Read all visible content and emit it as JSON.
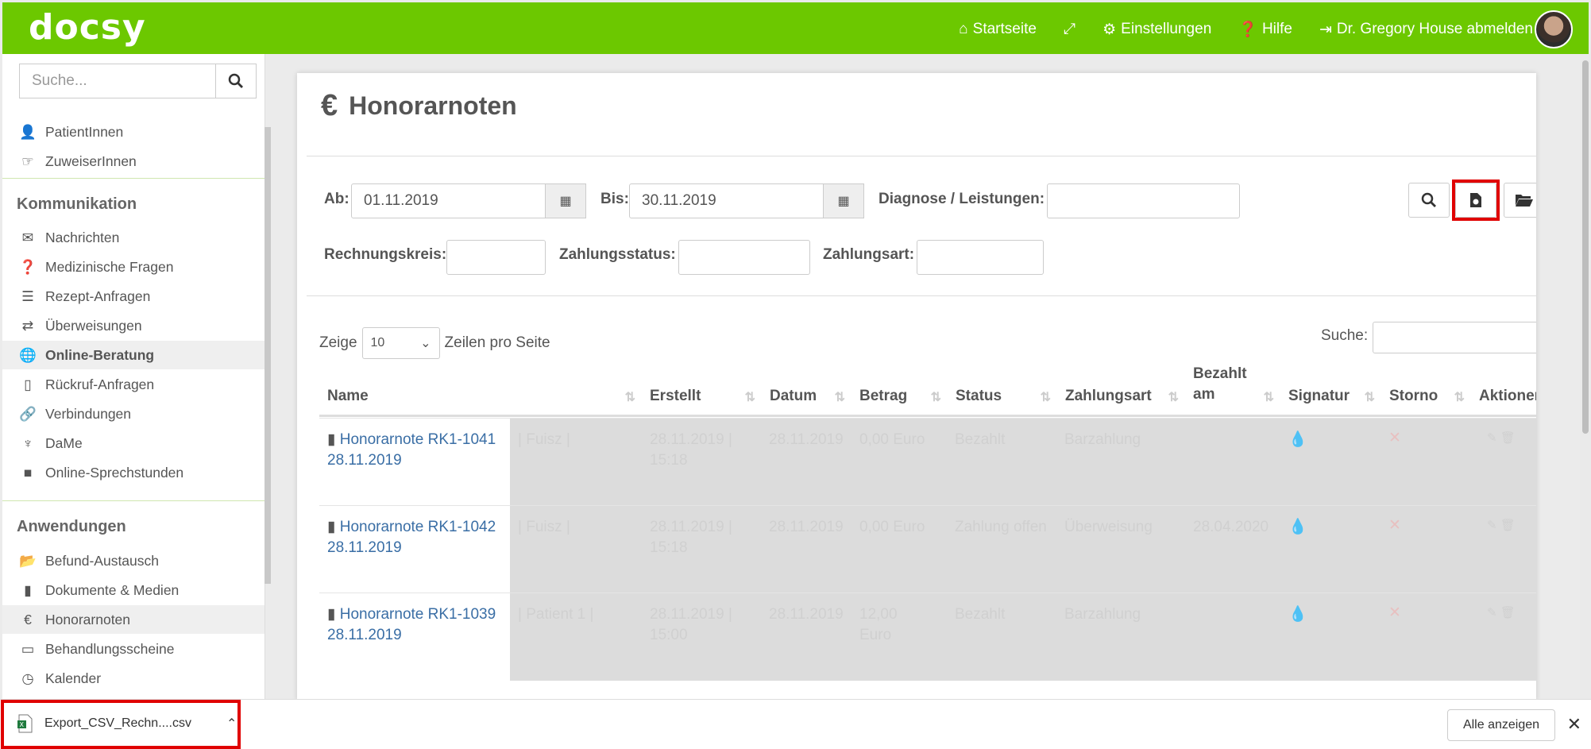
{
  "app": {
    "logo": "docsy",
    "brand_color": "#6cc800"
  },
  "topnav": {
    "home": "Startseite",
    "settings": "Einstellungen",
    "help": "Hilfe",
    "logout": "Dr. Gregory House abmelden"
  },
  "sidebar": {
    "search_placeholder": "Suche...",
    "items_top": [
      {
        "label": "PatientInnen",
        "icon": "user-icon"
      },
      {
        "label": "ZuweiserInnen",
        "icon": "hand-pointer-icon"
      }
    ],
    "section_comm": "Kommunikation",
    "items_comm": [
      {
        "label": "Nachrichten",
        "icon": "envelope-icon"
      },
      {
        "label": "Medizinische Fragen",
        "icon": "question-circle-icon"
      },
      {
        "label": "Rezept-Anfragen",
        "icon": "list-icon"
      },
      {
        "label": "Überweisungen",
        "icon": "exchange-icon"
      },
      {
        "label": "Online-Beratung",
        "icon": "globe-icon"
      },
      {
        "label": "Rückruf-Anfragen",
        "icon": "mobile-icon"
      },
      {
        "label": "Verbindungen",
        "icon": "link-icon"
      },
      {
        "label": "DaMe",
        "icon": "dame-icon"
      },
      {
        "label": "Online-Sprechstunden",
        "icon": "video-icon"
      }
    ],
    "section_apps": "Anwendungen",
    "items_apps": [
      {
        "label": "Befund-Austausch",
        "icon": "folder-open-icon"
      },
      {
        "label": "Dokumente & Medien",
        "icon": "file-icon"
      },
      {
        "label": "Honorarnoten",
        "icon": "euro-icon"
      },
      {
        "label": "Behandlungsscheine",
        "icon": "inbox-icon"
      },
      {
        "label": "Kalender",
        "icon": "clock-icon"
      }
    ]
  },
  "page": {
    "title": "Honorarnoten",
    "filters": {
      "from_label": "Ab:",
      "from_value": "01.11.2019",
      "to_label": "Bis:",
      "to_value": "30.11.2019",
      "diagnosis_label": "Diagnose / Leistungen:",
      "circle_label": "Rechnungskreis:",
      "paystatus_label": "Zahlungsstatus:",
      "paytype_label": "Zahlungsart:"
    },
    "table_controls": {
      "show_label": "Zeige",
      "page_size": "10",
      "rows_label": "Zeilen pro Seite",
      "search_label": "Suche:"
    },
    "columns": [
      "Name",
      "Erstellt",
      "Datum",
      "Betrag",
      "Status",
      "Zahlungsart",
      "Bezahlt am",
      "Signatur",
      "Storno",
      "Aktionen"
    ],
    "rows": [
      {
        "name": "Honorarnote RK1-1041",
        "date_line": "28.11.2019",
        "patient": "| Fuisz |",
        "created": "28.11.2019 | 15:18",
        "datum": "28.11.2019",
        "amount": "0,00 Euro",
        "status": "Bezahlt",
        "paytype": "Barzahlung",
        "paid_at": ""
      },
      {
        "name": "Honorarnote RK1-1042",
        "date_line": "28.11.2019",
        "patient": "| Fuisz |",
        "created": "28.11.2019 | 15:18",
        "datum": "28.11.2019",
        "amount": "0,00 Euro",
        "status": "Zahlung offen",
        "paytype": "Überweisung",
        "paid_at": "28.04.2020"
      },
      {
        "name": "Honorarnote RK1-1039",
        "date_line": "28.11.2019",
        "patient": "| Patient 1 |",
        "created": "28.11.2019 | 15:00",
        "datum": "28.11.2019",
        "amount": "12,00 Euro",
        "status": "Bezahlt",
        "paytype": "Barzahlung",
        "paid_at": ""
      }
    ]
  },
  "download": {
    "filename": "Export_CSV_Rechn....csv",
    "show_all": "Alle anzeigen"
  }
}
